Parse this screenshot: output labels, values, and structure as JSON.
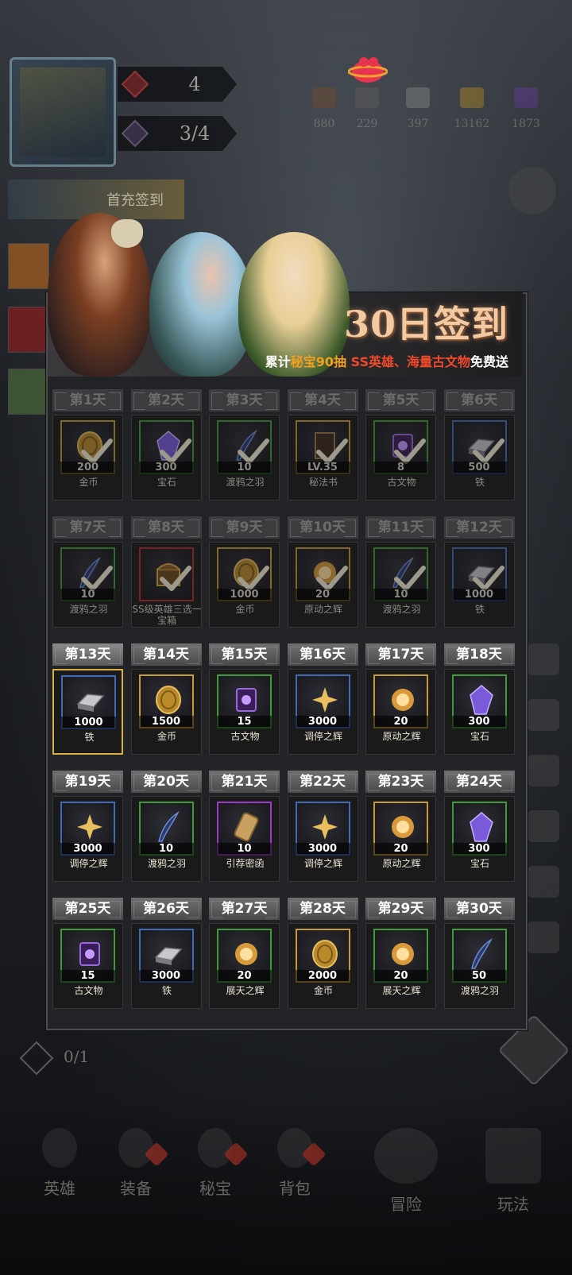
{
  "hud": {
    "stat1_value": "4",
    "stat2_value": "3/4",
    "resources": [
      {
        "icon": "ore-icon",
        "value": "880"
      },
      {
        "icon": "stone-icon",
        "value": "229"
      },
      {
        "icon": "iron-icon",
        "value": "397"
      },
      {
        "icon": "gold-icon",
        "value": "13162"
      },
      {
        "icon": "crystal-icon",
        "value": "1873"
      }
    ],
    "checkin_tag": "首充签到"
  },
  "banner": {
    "title": "30日签到",
    "sub_prefix": "累计",
    "sub_hl1": "秘宝90抽",
    "sub_hl2": "SS英雄、海量古文物",
    "sub_suffix": "免费送"
  },
  "days": [
    {
      "label": "第1天",
      "qty": "200",
      "name": "金币",
      "border": "gold",
      "icon": "coin-icon",
      "claimed": true
    },
    {
      "label": "第2天",
      "qty": "300",
      "name": "宝石",
      "border": "green",
      "icon": "gem-icon",
      "claimed": true
    },
    {
      "label": "第3天",
      "qty": "10",
      "name": "渡鸦之羽",
      "border": "green",
      "icon": "feather-icon",
      "claimed": true
    },
    {
      "label": "第4天",
      "qty": "LV.35",
      "name": "秘法书",
      "border": "gold",
      "icon": "book-icon",
      "claimed": true
    },
    {
      "label": "第5天",
      "qty": "8",
      "name": "古文物",
      "border": "green",
      "icon": "relic-icon",
      "claimed": true
    },
    {
      "label": "第6天",
      "qty": "500",
      "name": "铁",
      "border": "blue",
      "icon": "iron-icon",
      "claimed": true
    },
    {
      "label": "第7天",
      "qty": "10",
      "name": "渡鸦之羽",
      "border": "green",
      "icon": "feather-icon",
      "claimed": true
    },
    {
      "label": "第8天",
      "qty": "",
      "name": "SS级英雄三选一宝箱",
      "border": "red",
      "icon": "chest-icon",
      "claimed": true
    },
    {
      "label": "第9天",
      "qty": "1000",
      "name": "金币",
      "border": "gold",
      "icon": "coin-icon",
      "claimed": true
    },
    {
      "label": "第10天",
      "qty": "20",
      "name": "原动之辉",
      "border": "gold",
      "icon": "sun-orb-icon",
      "claimed": true
    },
    {
      "label": "第11天",
      "qty": "10",
      "name": "渡鸦之羽",
      "border": "green",
      "icon": "feather-icon",
      "claimed": true
    },
    {
      "label": "第12天",
      "qty": "1000",
      "name": "铁",
      "border": "blue",
      "icon": "iron-icon",
      "claimed": true
    },
    {
      "label": "第13天",
      "qty": "1000",
      "name": "铁",
      "border": "blue",
      "icon": "iron-icon",
      "claimed": false,
      "today": true
    },
    {
      "label": "第14天",
      "qty": "1500",
      "name": "金币",
      "border": "gold",
      "icon": "coin-icon",
      "claimed": false
    },
    {
      "label": "第15天",
      "qty": "15",
      "name": "古文物",
      "border": "green",
      "icon": "relic-icon",
      "claimed": false
    },
    {
      "label": "第16天",
      "qty": "3000",
      "name": "调停之辉",
      "border": "blue",
      "icon": "star-orb-icon",
      "claimed": false
    },
    {
      "label": "第17天",
      "qty": "20",
      "name": "原动之辉",
      "border": "gold",
      "icon": "sun-orb-icon",
      "claimed": false
    },
    {
      "label": "第18天",
      "qty": "300",
      "name": "宝石",
      "border": "green",
      "icon": "gem-icon",
      "claimed": false
    },
    {
      "label": "第19天",
      "qty": "3000",
      "name": "调停之辉",
      "border": "blue",
      "icon": "star-orb-icon",
      "claimed": false
    },
    {
      "label": "第20天",
      "qty": "10",
      "name": "渡鸦之羽",
      "border": "green",
      "icon": "feather-icon",
      "claimed": false
    },
    {
      "label": "第21天",
      "qty": "10",
      "name": "引荐密函",
      "border": "purple",
      "icon": "scroll-icon",
      "claimed": false
    },
    {
      "label": "第22天",
      "qty": "3000",
      "name": "调停之辉",
      "border": "blue",
      "icon": "star-orb-icon",
      "claimed": false
    },
    {
      "label": "第23天",
      "qty": "20",
      "name": "原动之辉",
      "border": "gold",
      "icon": "sun-orb-icon",
      "claimed": false
    },
    {
      "label": "第24天",
      "qty": "300",
      "name": "宝石",
      "border": "green",
      "icon": "gem-icon",
      "claimed": false
    },
    {
      "label": "第25天",
      "qty": "15",
      "name": "古文物",
      "border": "green",
      "icon": "relic-icon",
      "claimed": false
    },
    {
      "label": "第26天",
      "qty": "3000",
      "name": "铁",
      "border": "blue",
      "icon": "iron-icon",
      "claimed": false
    },
    {
      "label": "第27天",
      "qty": "20",
      "name": "展天之辉",
      "border": "green",
      "icon": "sun-orb-icon",
      "claimed": false
    },
    {
      "label": "第28天",
      "qty": "2000",
      "name": "金币",
      "border": "gold",
      "icon": "coin-icon",
      "claimed": false
    },
    {
      "label": "第29天",
      "qty": "20",
      "name": "展天之辉",
      "border": "green",
      "icon": "sun-orb-icon",
      "claimed": false
    },
    {
      "label": "第30天",
      "qty": "50",
      "name": "渡鸦之羽",
      "border": "green",
      "icon": "feather-icon",
      "claimed": false
    }
  ],
  "left_counter": "0/1",
  "nav": [
    {
      "label": "英雄",
      "icon": "hero-icon"
    },
    {
      "label": "装备",
      "icon": "equipment-icon"
    },
    {
      "label": "秘宝",
      "icon": "treasure-icon"
    },
    {
      "label": "背包",
      "icon": "bag-icon"
    },
    {
      "label": "冒险",
      "icon": "crossed-swords-icon"
    },
    {
      "label": "玩法",
      "icon": "castle-icon"
    }
  ],
  "colors": {
    "accent_gold": "#d9b040",
    "title_glow": "#f2c9a0",
    "highlight_orange": "#f2a020",
    "highlight_red": "#f04a2a"
  }
}
